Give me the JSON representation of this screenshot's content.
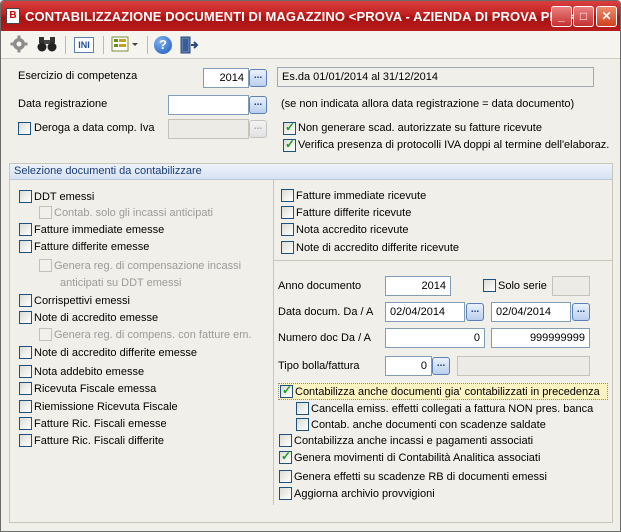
{
  "window": {
    "title": "CONTABILIZZAZIONE DOCUMENTI DI MAGAZZINO <PROVA - AZIENDA DI PROVA PRE>",
    "app_icon_glyph": "B",
    "min_glyph": "_",
    "max_glyph": "□",
    "close_glyph": "✕"
  },
  "toolbar": {
    "icons": [
      "settings-icon",
      "binoculars-icon",
      "ini-icon",
      "list-options-icon",
      "help-icon",
      "exit-icon"
    ],
    "ini_label": "INI",
    "help_glyph": "?"
  },
  "top": {
    "esercizio_label": "Esercizio di competenza",
    "esercizio_value": "2014",
    "esercizio_range": "Es.da 01/01/2014 al 31/12/2014",
    "data_reg_label": "Data registrazione",
    "data_reg_value": "",
    "data_reg_note": "(se non indicata  allora data registrazione = data documento)",
    "deroga_label": "Deroga a data comp. Iva",
    "deroga_value": "",
    "non_generare_label": "Non generare scad. autorizzate su fatture ricevute",
    "verifica_label": "Verifica presenza di protocolli IVA doppi al termine dell'elaboraz.",
    "dots": "..."
  },
  "selection": {
    "title": "Selezione documenti da contabilizzare",
    "left": {
      "ddt_emessi": "DDT emessi",
      "contab_incassi": "Contab. solo gli incassi anticipati",
      "fatture_immediate": "Fatture immediate emesse",
      "fatture_differite": "Fatture differite emesse",
      "genera_comp_1": "Genera reg. di compensazione incassi",
      "genera_comp_2": "anticipati su DDT emessi",
      "corrispettivi": "Corrispettivi emessi",
      "note_accredito": "Note di accredito emesse",
      "genera_comp_fatture": "Genera reg. di compens. con fatture em.",
      "note_accredito_differite": "Note di accredito differite emesse",
      "nota_addebito": "Nota addebito emesse",
      "ricevuta_fiscale": "Ricevuta Fiscale emessa",
      "riemissione_ricevuta": "Riemissione Ricevuta Fiscale",
      "fatture_ric_fiscali": "Fatture Ric. Fiscali emesse",
      "fatture_ric_fiscali_diff": "Fatture Ric. Fiscali differite"
    },
    "right": {
      "fatture_immediate_ricevute": "Fatture immediate ricevute",
      "fatture_differite_ricevute": "Fatture differite ricevute",
      "nota_accredito_ricevute": "Nota accredito ricevute",
      "note_accredito_diff_ricevute": "Note di accredito differite ricevute",
      "anno_doc_label": "Anno documento",
      "anno_doc_value": "2014",
      "solo_serie_label": "Solo serie",
      "solo_serie_value": "",
      "data_doc_label": "Data docum. Da / A",
      "data_doc_from": "02/04/2014",
      "data_doc_to": "02/04/2014",
      "numero_doc_label": "Numero doc Da / A",
      "numero_doc_from": "0",
      "numero_doc_to": "999999999",
      "tipo_bolla_label": "Tipo bolla/fattura",
      "tipo_bolla_value": "0",
      "tipo_bolla_desc": "",
      "contabilizza_gia": "Contabilizza anche documenti gia' contabilizzati in precedenza",
      "cancella_emiss": "Cancella emiss. effetti collegati a fattura NON pres. banca",
      "contab_scadenze": "Contab. anche documenti con scadenze saldate",
      "contabilizza_incassi": "Contabilizza anche incassi e pagamenti associati",
      "genera_movimenti": "Genera movimenti di Contabilità Analitica associati",
      "genera_effetti": "Genera effetti su scadenze RB di documenti emessi",
      "aggiorna_provvigioni": "Aggiorna archivio provvigioni"
    }
  }
}
